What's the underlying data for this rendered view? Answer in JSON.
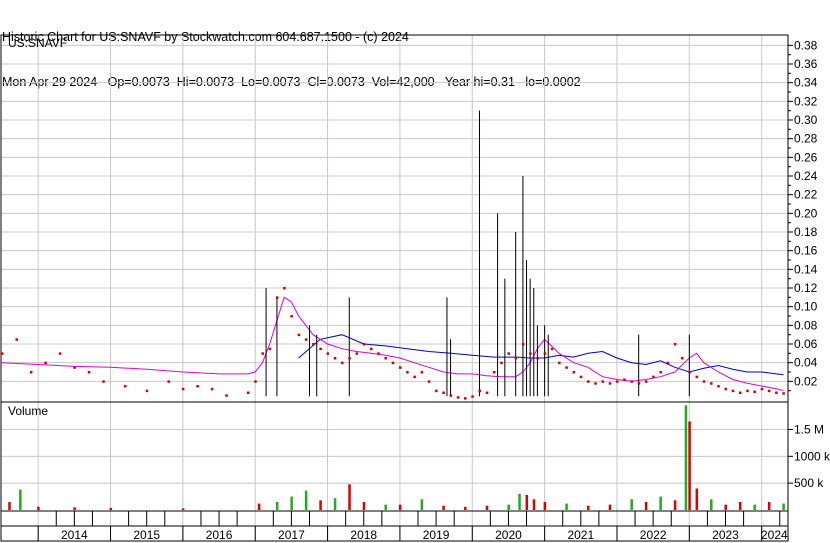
{
  "header": {
    "title_line": "Historic Chart for US:SNAVF by Stockwatch.com 604.687.1500 - (c) 2024",
    "stats_line": "Mon Apr 29 2024   Op=0.0073  Hi=0.0073  Lo=0.0073  Cl=0.0073  Vol=42,000   Year hi=0.31   lo=0.0002"
  },
  "chart_data": [
    {
      "type": "line",
      "title": "US:SNAVF",
      "ylim": [
        0,
        0.39
      ],
      "yticks": [
        "0.02",
        "0.04",
        "0.06",
        "0.08",
        "0.10",
        "0.12",
        "0.14",
        "0.16",
        "0.18",
        "0.20",
        "0.22",
        "0.24",
        "0.26",
        "0.28",
        "0.30",
        "0.32",
        "0.34",
        "0.36",
        "0.38"
      ],
      "x_years": [
        "2014",
        "2015",
        "2016",
        "2017",
        "2018",
        "2019",
        "2020",
        "2021",
        "2022",
        "2023",
        "2024"
      ],
      "colors": {
        "price": "#d40000",
        "spike": "#000000",
        "ma_long": "#0000cc",
        "ma_short": "#e000e0",
        "grid": "#c8c8c8"
      },
      "series": [
        {
          "role": "close_price",
          "x": [
            2013.5,
            2013.7,
            2013.9,
            2014.1,
            2014.3,
            2014.5,
            2014.7,
            2014.9,
            2015.2,
            2015.5,
            2015.8,
            2016.0,
            2016.2,
            2016.4,
            2016.6,
            2016.9,
            2017.0,
            2017.1,
            2017.2,
            2017.3,
            2017.4,
            2017.5,
            2017.6,
            2017.7,
            2017.8,
            2017.9,
            2018.0,
            2018.1,
            2018.2,
            2018.3,
            2018.4,
            2018.5,
            2018.6,
            2018.7,
            2018.8,
            2018.9,
            2019.0,
            2019.1,
            2019.2,
            2019.3,
            2019.4,
            2019.5,
            2019.6,
            2019.7,
            2019.8,
            2019.9,
            2020.0,
            2020.1,
            2020.2,
            2020.3,
            2020.4,
            2020.5,
            2020.6,
            2020.7,
            2020.8,
            2020.9,
            2021.0,
            2021.1,
            2021.2,
            2021.3,
            2021.4,
            2021.5,
            2021.6,
            2021.7,
            2021.8,
            2021.9,
            2022.0,
            2022.1,
            2022.2,
            2022.3,
            2022.4,
            2022.5,
            2022.6,
            2022.7,
            2022.8,
            2022.9,
            2023.0,
            2023.1,
            2023.2,
            2023.3,
            2023.4,
            2023.5,
            2023.6,
            2023.7,
            2023.8,
            2023.9,
            2024.0,
            2024.1,
            2024.2,
            2024.3
          ],
          "values": [
            0.05,
            0.065,
            0.03,
            0.04,
            0.05,
            0.035,
            0.03,
            0.02,
            0.015,
            0.01,
            0.02,
            0.012,
            0.015,
            0.012,
            0.005,
            0.008,
            0.02,
            0.05,
            0.055,
            0.11,
            0.12,
            0.09,
            0.07,
            0.065,
            0.06,
            0.055,
            0.05,
            0.045,
            0.04,
            0.045,
            0.05,
            0.06,
            0.055,
            0.05,
            0.045,
            0.04,
            0.035,
            0.03,
            0.025,
            0.03,
            0.02,
            0.01,
            0.008,
            0.005,
            0.003,
            0.002,
            0.004,
            0.01,
            0.008,
            0.03,
            0.04,
            0.05,
            0.045,
            0.06,
            0.05,
            0.045,
            0.05,
            0.055,
            0.04,
            0.035,
            0.03,
            0.025,
            0.02,
            0.018,
            0.02,
            0.018,
            0.02,
            0.022,
            0.02,
            0.018,
            0.02,
            0.025,
            0.03,
            0.04,
            0.06,
            0.045,
            0.03,
            0.025,
            0.02,
            0.018,
            0.015,
            0.012,
            0.01,
            0.008,
            0.01,
            0.009,
            0.012,
            0.01,
            0.008,
            0.0073
          ]
        },
        {
          "role": "high_spikes",
          "x": [
            2017.15,
            2017.3,
            2017.75,
            2017.85,
            2018.3,
            2019.65,
            2019.7,
            2020.1,
            2020.35,
            2020.45,
            2020.6,
            2020.7,
            2020.75,
            2020.8,
            2020.85,
            2020.9,
            2021.0,
            2021.05,
            2022.3,
            2023.0
          ],
          "values": [
            0.12,
            0.11,
            0.08,
            0.07,
            0.11,
            0.11,
            0.065,
            0.31,
            0.2,
            0.13,
            0.18,
            0.24,
            0.15,
            0.13,
            0.12,
            0.08,
            0.08,
            0.07,
            0.07,
            0.07
          ]
        },
        {
          "role": "moving_average_long",
          "x": [
            2017.6,
            2017.9,
            2018.2,
            2018.5,
            2018.8,
            2019.1,
            2019.4,
            2019.7,
            2020.0,
            2020.3,
            2020.6,
            2020.8,
            2021.0,
            2021.2,
            2021.4,
            2021.6,
            2021.8,
            2022.0,
            2022.2,
            2022.4,
            2022.6,
            2022.8,
            2023.0,
            2023.2,
            2023.4,
            2023.6,
            2023.8,
            2024.0,
            2024.3
          ],
          "values": [
            0.045,
            0.065,
            0.07,
            0.06,
            0.058,
            0.055,
            0.052,
            0.05,
            0.048,
            0.046,
            0.046,
            0.045,
            0.045,
            0.048,
            0.046,
            0.05,
            0.052,
            0.045,
            0.04,
            0.038,
            0.042,
            0.035,
            0.03,
            0.034,
            0.037,
            0.033,
            0.03,
            0.03,
            0.027
          ]
        },
        {
          "role": "moving_average_short",
          "x": [
            2013.5,
            2014.0,
            2014.5,
            2015.0,
            2015.5,
            2016.0,
            2016.5,
            2016.9,
            2017.0,
            2017.1,
            2017.2,
            2017.3,
            2017.4,
            2017.5,
            2017.6,
            2017.8,
            2018.0,
            2018.2,
            2018.4,
            2018.6,
            2018.8,
            2019.0,
            2019.2,
            2019.4,
            2019.6,
            2019.8,
            2020.0,
            2020.2,
            2020.4,
            2020.6,
            2020.7,
            2020.8,
            2020.9,
            2021.0,
            2021.2,
            2021.4,
            2021.6,
            2021.8,
            2022.0,
            2022.2,
            2022.4,
            2022.6,
            2022.8,
            2023.0,
            2023.1,
            2023.2,
            2023.4,
            2023.6,
            2023.8,
            2024.0,
            2024.2,
            2024.3
          ],
          "values": [
            0.04,
            0.038,
            0.036,
            0.035,
            0.033,
            0.03,
            0.028,
            0.028,
            0.03,
            0.04,
            0.06,
            0.085,
            0.11,
            0.105,
            0.09,
            0.07,
            0.06,
            0.055,
            0.052,
            0.05,
            0.048,
            0.045,
            0.04,
            0.035,
            0.03,
            0.028,
            0.028,
            0.026,
            0.025,
            0.025,
            0.03,
            0.04,
            0.055,
            0.065,
            0.05,
            0.04,
            0.035,
            0.025,
            0.022,
            0.02,
            0.022,
            0.025,
            0.03,
            0.045,
            0.05,
            0.04,
            0.03,
            0.022,
            0.018,
            0.015,
            0.012,
            0.01
          ]
        }
      ]
    },
    {
      "type": "bar",
      "title": "Volume",
      "yticks": [
        "500 k",
        "1000 k",
        "1.5 M"
      ],
      "ylim": [
        0,
        1900000
      ],
      "colors": {
        "up": "#22aa22",
        "down": "#dd0000"
      },
      "series": [
        {
          "role": "volume",
          "x": [
            2013.6,
            2013.75,
            2014.0,
            2014.5,
            2015.0,
            2016.0,
            2017.05,
            2017.3,
            2017.5,
            2017.7,
            2017.9,
            2018.1,
            2018.3,
            2018.5,
            2018.8,
            2019.0,
            2019.3,
            2019.6,
            2019.9,
            2020.2,
            2020.5,
            2020.65,
            2020.75,
            2020.85,
            2021.0,
            2021.3,
            2021.6,
            2021.9,
            2022.2,
            2022.4,
            2022.6,
            2022.8,
            2022.95,
            2023.0,
            2023.1,
            2023.3,
            2023.5,
            2023.7,
            2023.9,
            2024.1,
            2024.3
          ],
          "values": [
            150000,
            380000,
            60000,
            50000,
            40000,
            30000,
            120000,
            150000,
            250000,
            360000,
            180000,
            220000,
            480000,
            150000,
            100000,
            100000,
            200000,
            80000,
            60000,
            80000,
            100000,
            300000,
            280000,
            200000,
            150000,
            120000,
            80000,
            100000,
            200000,
            150000,
            250000,
            180000,
            1950000,
            1650000,
            400000,
            200000,
            100000,
            150000,
            100000,
            150000,
            120000
          ],
          "up": [
            false,
            true,
            false,
            false,
            false,
            false,
            false,
            true,
            true,
            true,
            false,
            true,
            false,
            false,
            true,
            false,
            true,
            false,
            false,
            false,
            true,
            true,
            false,
            false,
            false,
            true,
            false,
            false,
            true,
            false,
            true,
            false,
            true,
            false,
            false,
            true,
            false,
            false,
            true,
            false,
            true
          ]
        }
      ]
    }
  ]
}
